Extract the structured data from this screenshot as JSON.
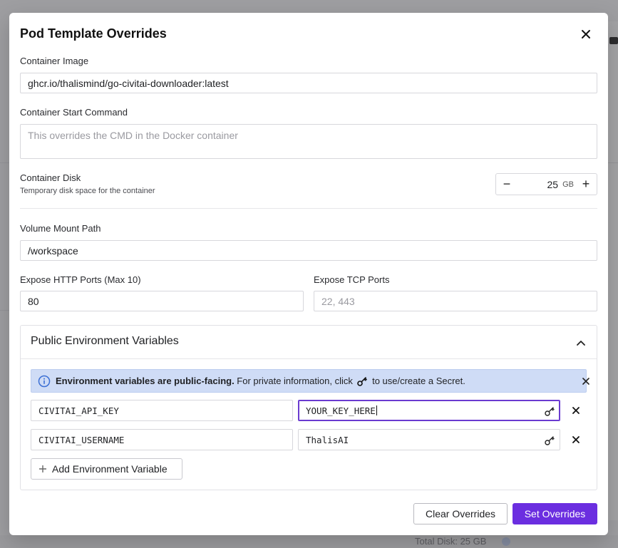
{
  "background": {
    "footer_text": "Total Disk: 25 GB"
  },
  "modal": {
    "title": "Pod Template Overrides",
    "close_icon": "close-icon"
  },
  "container_image": {
    "label": "Container Image",
    "value": "ghcr.io/thalismind/go-civitai-downloader:latest"
  },
  "start_command": {
    "label": "Container Start Command",
    "placeholder": "This overrides the CMD in the Docker container"
  },
  "container_disk": {
    "label": "Container Disk",
    "sublabel": "Temporary disk space for the container",
    "value": "25",
    "unit": "GB",
    "decrement": "−",
    "increment": "+"
  },
  "volume_mount": {
    "label": "Volume Mount Path",
    "value": "/workspace"
  },
  "http_ports": {
    "label": "Expose HTTP Ports (Max 10)",
    "value": "80"
  },
  "tcp_ports": {
    "label": "Expose TCP Ports",
    "placeholder": "22, 443"
  },
  "env_section": {
    "title": "Public Environment Variables",
    "info_bold": "Environment variables are public-facing.",
    "info_text_1": " For private information, click ",
    "info_text_2": " to use/create a Secret.",
    "variables": [
      {
        "key": "CIVITAI_API_KEY",
        "value": "YOUR_KEY_HERE"
      },
      {
        "key": "CIVITAI_USERNAME",
        "value": "ThalisAI"
      }
    ],
    "add_button": "Add Environment Variable"
  },
  "footer": {
    "clear_button": "Clear Overrides",
    "set_button": "Set Overrides"
  },
  "colors": {
    "accent": "#6b2ee0",
    "info_bg": "#cfdcf6",
    "info_icon": "#3b6fd4"
  }
}
